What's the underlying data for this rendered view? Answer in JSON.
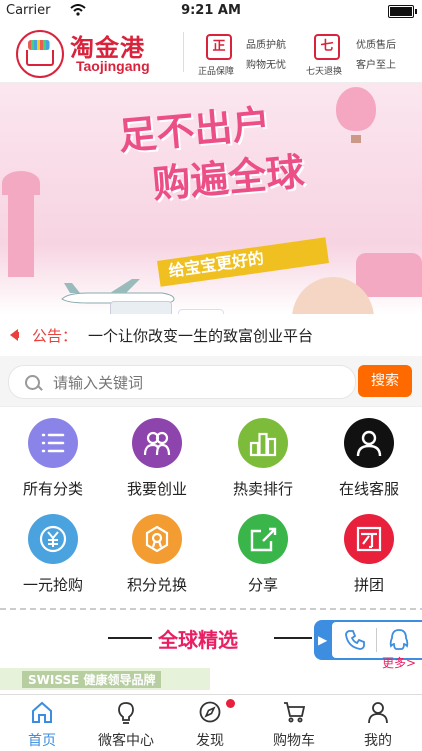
{
  "status_bar": {
    "carrier": "Carrier",
    "time": "9:21 AM"
  },
  "header": {
    "brand_cn": "淘金港",
    "brand_en": "Taojingang",
    "features": [
      {
        "icon_text": "正",
        "caption": "正品保障",
        "line1": "品质护航",
        "line2": "购物无忧"
      },
      {
        "icon_text": "七",
        "caption": "七天退换",
        "line1": "优质售后",
        "line2": "客户至上"
      }
    ]
  },
  "banner": {
    "title1": "足不出户",
    "title2": "购遍全球",
    "slogan": "给宝宝更好的"
  },
  "notice": {
    "label": "公告：",
    "message": "一个让你改变一生的致富创业平台"
  },
  "search": {
    "placeholder": "请输入关键词",
    "button": "搜索"
  },
  "grid": [
    {
      "label": "所有分类",
      "icon": "list-icon",
      "color": "#8b84e8"
    },
    {
      "label": "我要创业",
      "icon": "group-icon",
      "color": "#8e44ad"
    },
    {
      "label": "热卖排行",
      "icon": "ranking-icon",
      "color": "#7dbb3a"
    },
    {
      "label": "在线客服",
      "icon": "user-icon",
      "color": "#111111"
    },
    {
      "label": "一元抢购",
      "icon": "yen-icon",
      "color": "#4aa3df"
    },
    {
      "label": "积分兑换",
      "icon": "badge-icon",
      "color": "#f39c32"
    },
    {
      "label": "分享",
      "icon": "share-icon",
      "color": "#39b54a"
    },
    {
      "label": "拼团",
      "icon": "group-buy-icon",
      "color": "#e8203c"
    }
  ],
  "section": {
    "title": "全球精选",
    "more": "更多>",
    "promo": "SWISSE 健康领导品牌"
  },
  "tabs": [
    {
      "label": "首页",
      "icon": "home-icon",
      "active": true
    },
    {
      "label": "微客中心",
      "icon": "bulb-icon",
      "active": false
    },
    {
      "label": "发现",
      "icon": "compass-icon",
      "active": false
    },
    {
      "label": "购物车",
      "icon": "cart-icon",
      "active": false
    },
    {
      "label": "我的",
      "icon": "profile-icon",
      "active": false
    }
  ],
  "colors": {
    "brand": "#d9233c",
    "accent": "#ff6a00",
    "tab_active": "#3c8de0",
    "section": "#e91e63"
  }
}
